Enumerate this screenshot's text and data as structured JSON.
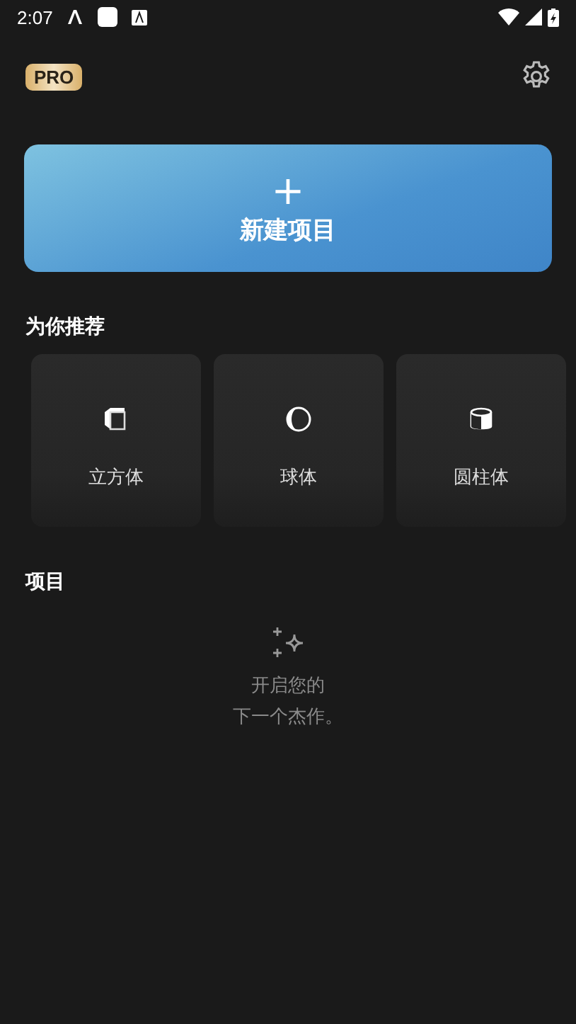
{
  "status_bar": {
    "time": "2:07"
  },
  "header": {
    "badge": "PRO"
  },
  "new_project": {
    "icon": "+",
    "label": "新建项目"
  },
  "recommended": {
    "title": "为你推荐",
    "items": [
      {
        "kind": "cube",
        "label": "立方体"
      },
      {
        "kind": "sphere",
        "label": "球体"
      },
      {
        "kind": "cylinder",
        "label": "圆柱体"
      }
    ]
  },
  "projects": {
    "title": "项目",
    "empty_lines": [
      "开启您的",
      "下一个杰作。"
    ]
  }
}
